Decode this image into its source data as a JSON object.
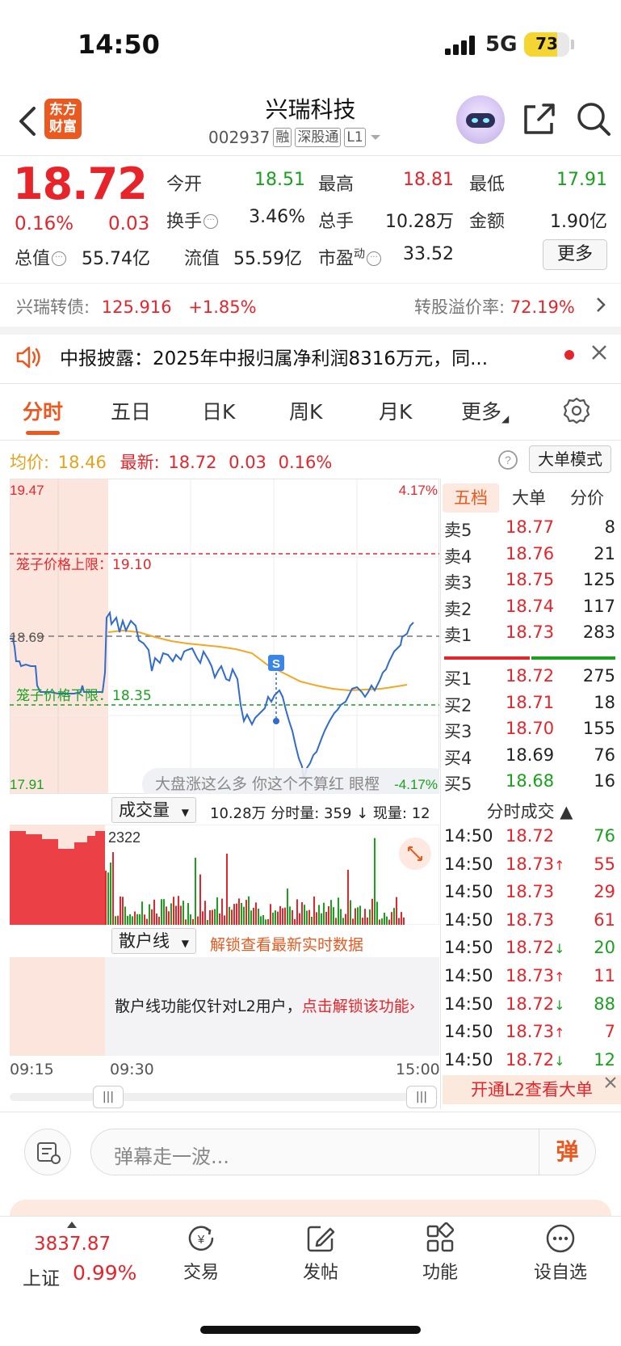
{
  "status_bar": {
    "time": "14:50",
    "network": "5G",
    "battery": "73",
    "battery_level": 0.73
  },
  "header": {
    "logo_line1": "东方",
    "logo_line2": "财富",
    "stock_name": "兴瑞科技",
    "stock_code": "002937",
    "tags": [
      "融",
      "深股通",
      "L1"
    ]
  },
  "quote": {
    "price": "18.72",
    "change_pct": "0.16%",
    "change_amt": "0.03",
    "open_label": "今开",
    "open": "18.51",
    "high_label": "最高",
    "high": "18.81",
    "low_label": "最低",
    "low": "17.91",
    "turnover_label": "换手",
    "turnover": "3.46%",
    "volume_label": "总手",
    "volume": "10.28万",
    "amount_label": "金额",
    "amount": "1.90亿",
    "mktcap_label": "总值",
    "mktcap": "55.74亿",
    "float_label": "流值",
    "float": "55.59亿",
    "pe_label": "市盈",
    "pe_sup": "动",
    "pe": "33.52",
    "more_label": "更多"
  },
  "bond": {
    "name": "兴瑞转债:",
    "price": "125.916",
    "change": "+1.85%",
    "premium_label": "转股溢价率:",
    "premium": "72.19%"
  },
  "notice": {
    "text": "中报披露：2025年中报归属净利润8316万元，同..."
  },
  "tabs": [
    "分时",
    "五日",
    "日K",
    "周K",
    "月K",
    "更多"
  ],
  "avg_row": {
    "avg_label": "均价:",
    "avg": "18.46",
    "latest_label": "最新:",
    "latest": "18.72",
    "change": "0.03",
    "change_pct": "0.16%",
    "big_order_btn": "大单模式"
  },
  "chart": {
    "y_high": "19.47",
    "y_low": "17.91",
    "y_prev": "18.69",
    "pct_high": "4.17%",
    "pct_low": "-4.17%",
    "upper_limit_label": "笼子价格上限：19.10",
    "lower_limit_label": "笼子价格下限：18.35",
    "popup_text": "大盘涨这么多 你这个不算红 眼樫",
    "s_marker": "S",
    "colors": {
      "price_line": "#2f6bd0",
      "avg_line": "#f5a623",
      "pre_market": "#fce5dc",
      "up": "#e8242b",
      "down": "#19a11e"
    }
  },
  "volume": {
    "selector": "成交量",
    "summary": "10.28万 分时量: 359 ↓ 现量: 12",
    "max_label": "2322"
  },
  "retail": {
    "selector": "散户线",
    "unlock_link": "解锁查看最新实时数据",
    "message": "散户线功能仅针对L2用户，",
    "message_link": "点击解锁该功能›"
  },
  "time_axis": {
    "start": "09:15",
    "open": "09:30",
    "end": "15:00"
  },
  "order_book": {
    "tabs": [
      "五档",
      "大单",
      "分价"
    ],
    "asks": [
      {
        "label": "卖5",
        "price": "18.77",
        "qty": "8"
      },
      {
        "label": "卖4",
        "price": "18.76",
        "qty": "21"
      },
      {
        "label": "卖3",
        "price": "18.75",
        "qty": "125"
      },
      {
        "label": "卖2",
        "price": "18.74",
        "qty": "117"
      },
      {
        "label": "卖1",
        "price": "18.73",
        "qty": "283"
      }
    ],
    "bids": [
      {
        "label": "买1",
        "price": "18.72",
        "qty": "275"
      },
      {
        "label": "买2",
        "price": "18.71",
        "qty": "18"
      },
      {
        "label": "买3",
        "price": "18.70",
        "qty": "155"
      },
      {
        "label": "买4",
        "price": "18.69",
        "qty": "76"
      },
      {
        "label": "买5",
        "price": "18.68",
        "qty": "16"
      }
    ]
  },
  "trades": {
    "header": "分时成交 ▲",
    "rows": [
      {
        "time": "14:50",
        "price": "18.72",
        "arrow": "",
        "qty": "76",
        "dir": "down"
      },
      {
        "time": "14:50",
        "price": "18.73",
        "arrow": "↑",
        "qty": "55",
        "dir": "up"
      },
      {
        "time": "14:50",
        "price": "18.73",
        "arrow": "",
        "qty": "29",
        "dir": "up"
      },
      {
        "time": "14:50",
        "price": "18.73",
        "arrow": "",
        "qty": "61",
        "dir": "up"
      },
      {
        "time": "14:50",
        "price": "18.72",
        "arrow": "↓",
        "qty": "20",
        "dir": "down"
      },
      {
        "time": "14:50",
        "price": "18.73",
        "arrow": "↑",
        "qty": "11",
        "dir": "up"
      },
      {
        "time": "14:50",
        "price": "18.72",
        "arrow": "↓",
        "qty": "88",
        "dir": "down"
      },
      {
        "time": "14:50",
        "price": "18.73",
        "arrow": "↑",
        "qty": "7",
        "dir": "up"
      },
      {
        "time": "14:50",
        "price": "18.72",
        "arrow": "↓",
        "qty": "12",
        "dir": "down"
      }
    ],
    "l2_banner": "开通L2查看大单"
  },
  "danmaku": {
    "placeholder": "弹幕走一波...",
    "send": "弹"
  },
  "bottom_nav": {
    "index_value": "3837.87",
    "index_name": "上证",
    "index_pct": "0.99%",
    "items": [
      "交易",
      "发帖",
      "功能",
      "设自选"
    ]
  }
}
